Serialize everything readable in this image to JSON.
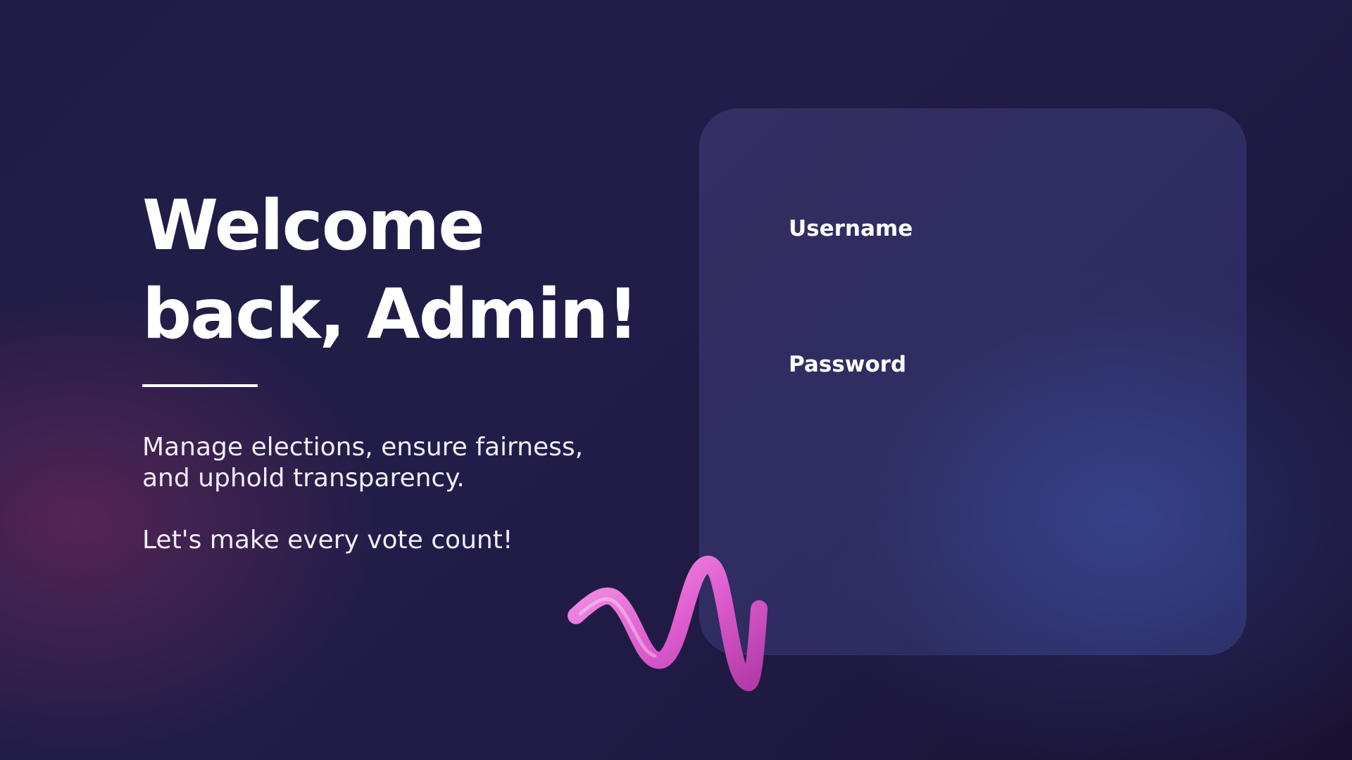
{
  "hero": {
    "title_line1": "Welcome",
    "title_line2": "back, Admin!",
    "description_line1": "Manage elections, ensure fairness,",
    "description_line2": "and uphold transparency.",
    "tagline": "Let's make every vote count!"
  },
  "login": {
    "username_label": "Username",
    "username_value": "",
    "password_label": "Password",
    "password_value": ""
  },
  "decoration": {
    "icon": "pink-3d-squiggle",
    "color_light": "#f59ae8",
    "color_mid": "#e05fd0",
    "color_dark": "#b23aa8"
  },
  "colors": {
    "background": "#211d48",
    "text": "#ffffff",
    "accent_glow": "#70285c"
  }
}
